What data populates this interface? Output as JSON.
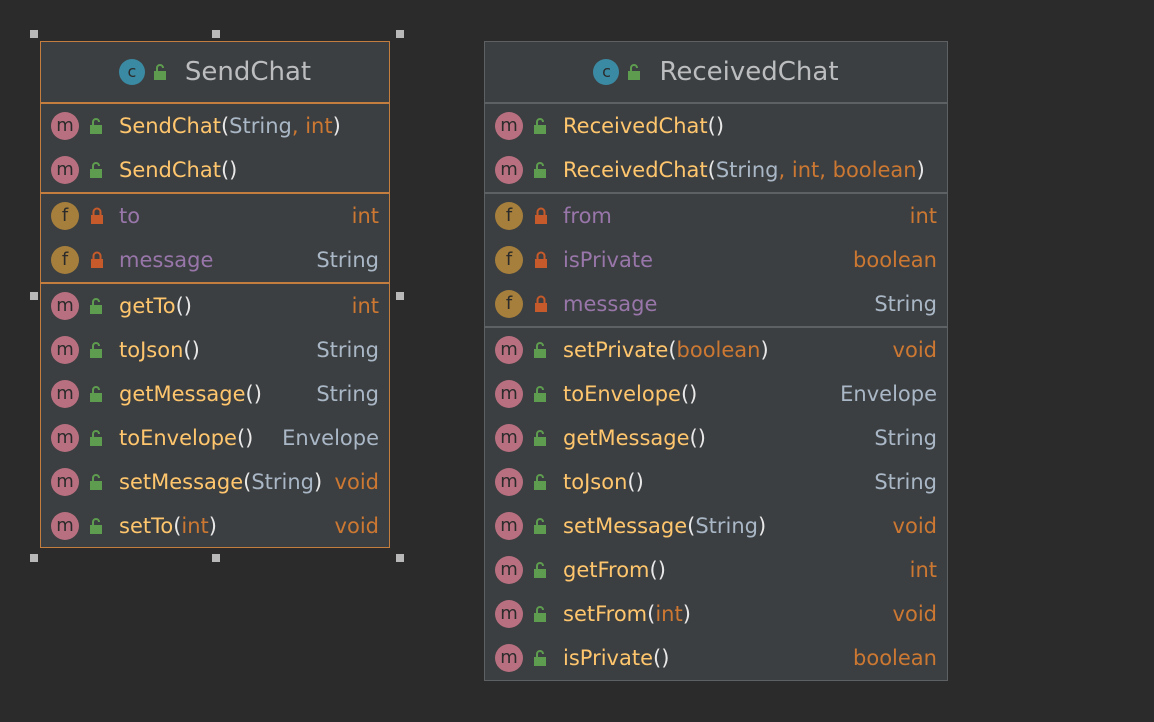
{
  "colors": {
    "background": "#2b2b2b",
    "box_fill": "#3c3f41",
    "selected_border": "#c27d3f",
    "border": "#5e6163",
    "method_badge": "#b87080",
    "field_badge": "#a67f3c",
    "class_badge": "#3b8aa3",
    "public_lock": "#5e9c4f",
    "private_lock": "#c75a2a"
  },
  "send_chat": {
    "badge": "c",
    "name": "SendChat",
    "constructors": [
      {
        "badge": "m",
        "name": "SendChat",
        "open": "(",
        "params": [
          {
            "text": "String",
            "kind": "cls"
          },
          {
            "text": "int",
            "kind": "kw"
          }
        ],
        "close": ")",
        "return": ""
      },
      {
        "badge": "m",
        "name": "SendChat",
        "open": "(",
        "params": [],
        "close": ")",
        "return": ""
      }
    ],
    "fields": [
      {
        "badge": "f",
        "name": "to",
        "type": "int",
        "type_kind": "kw"
      },
      {
        "badge": "f",
        "name": "message",
        "type": "String",
        "type_kind": "cls"
      }
    ],
    "methods": [
      {
        "badge": "m",
        "name": "getTo",
        "open": "(",
        "params": [],
        "close": ")",
        "return": "int",
        "return_kind": "kw"
      },
      {
        "badge": "m",
        "name": "toJson",
        "open": "(",
        "params": [],
        "close": ")",
        "return": "String",
        "return_kind": "cls"
      },
      {
        "badge": "m",
        "name": "getMessage",
        "open": "(",
        "params": [],
        "close": ")",
        "return": "String",
        "return_kind": "cls"
      },
      {
        "badge": "m",
        "name": "toEnvelope",
        "open": "(",
        "params": [],
        "close": ")",
        "return": "Envelope",
        "return_kind": "cls"
      },
      {
        "badge": "m",
        "name": "setMessage",
        "open": "(",
        "params": [
          {
            "text": "String",
            "kind": "cls"
          }
        ],
        "close": ")",
        "return": "void",
        "return_kind": "kw"
      },
      {
        "badge": "m",
        "name": "setTo",
        "open": "(",
        "params": [
          {
            "text": "int",
            "kind": "kw"
          }
        ],
        "close": ")",
        "return": "void",
        "return_kind": "kw"
      }
    ]
  },
  "received_chat": {
    "badge": "c",
    "name": "ReceivedChat",
    "constructors": [
      {
        "badge": "m",
        "name": "ReceivedChat",
        "open": "(",
        "params": [],
        "close": ")",
        "return": ""
      },
      {
        "badge": "m",
        "name": "ReceivedChat",
        "open": "(",
        "params": [
          {
            "text": "String",
            "kind": "cls"
          },
          {
            "text": "int",
            "kind": "kw"
          },
          {
            "text": "boolean",
            "kind": "kw"
          }
        ],
        "close": ")",
        "return": ""
      }
    ],
    "fields": [
      {
        "badge": "f",
        "name": "from",
        "type": "int",
        "type_kind": "kw"
      },
      {
        "badge": "f",
        "name": "isPrivate",
        "type": "boolean",
        "type_kind": "kw"
      },
      {
        "badge": "f",
        "name": "message",
        "type": "String",
        "type_kind": "cls"
      }
    ],
    "methods": [
      {
        "badge": "m",
        "name": "setPrivate",
        "open": "(",
        "params": [
          {
            "text": "boolean",
            "kind": "kw"
          }
        ],
        "close": ")",
        "return": "void",
        "return_kind": "kw"
      },
      {
        "badge": "m",
        "name": "toEnvelope",
        "open": "(",
        "params": [],
        "close": ")",
        "return": "Envelope",
        "return_kind": "cls"
      },
      {
        "badge": "m",
        "name": "getMessage",
        "open": "(",
        "params": [],
        "close": ")",
        "return": "String",
        "return_kind": "cls"
      },
      {
        "badge": "m",
        "name": "toJson",
        "open": "(",
        "params": [],
        "close": ")",
        "return": "String",
        "return_kind": "cls"
      },
      {
        "badge": "m",
        "name": "setMessage",
        "open": "(",
        "params": [
          {
            "text": "String",
            "kind": "cls"
          }
        ],
        "close": ")",
        "return": "void",
        "return_kind": "kw"
      },
      {
        "badge": "m",
        "name": "getFrom",
        "open": "(",
        "params": [],
        "close": ")",
        "return": "int",
        "return_kind": "kw"
      },
      {
        "badge": "m",
        "name": "setFrom",
        "open": "(",
        "params": [
          {
            "text": "int",
            "kind": "kw"
          }
        ],
        "close": ")",
        "return": "void",
        "return_kind": "kw"
      },
      {
        "badge": "m",
        "name": "isPrivate",
        "open": "(",
        "params": [],
        "close": ")",
        "return": "boolean",
        "return_kind": "kw"
      }
    ]
  }
}
